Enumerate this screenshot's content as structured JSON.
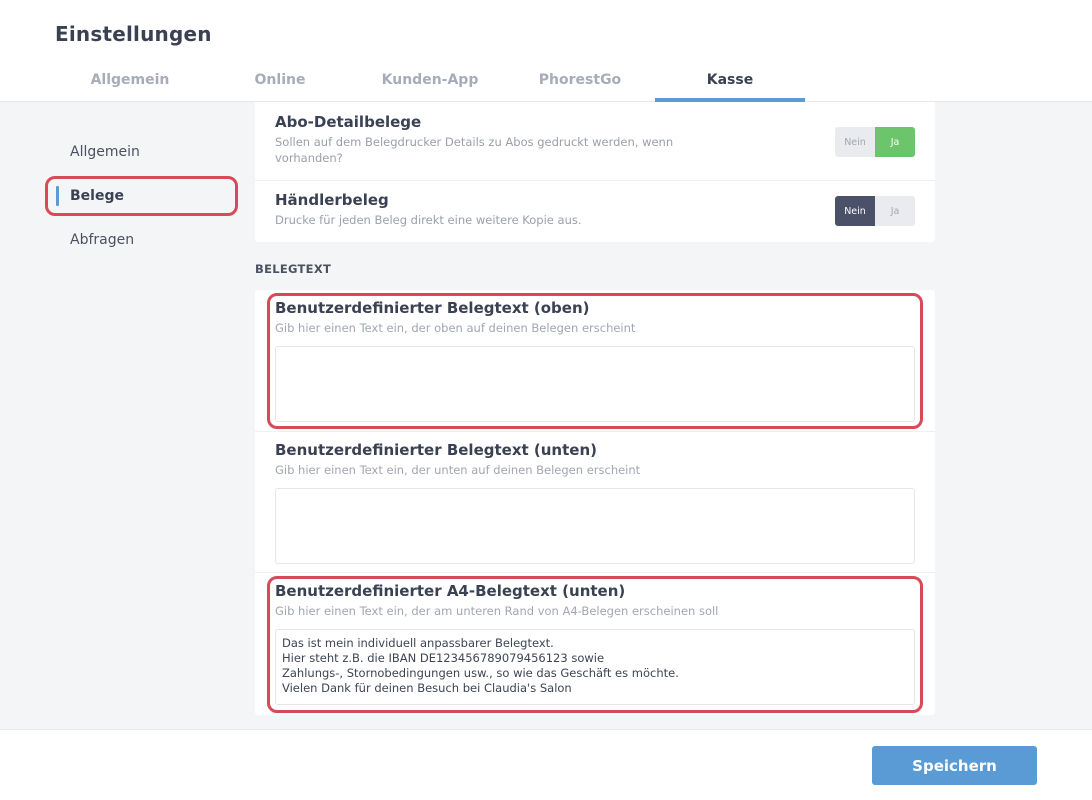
{
  "header": {
    "title": "Einstellungen",
    "tabs": [
      {
        "label": "Allgemein"
      },
      {
        "label": "Online"
      },
      {
        "label": "Kunden-App"
      },
      {
        "label": "PhorestGo"
      },
      {
        "label": "Kasse"
      }
    ],
    "active_tab": "Kasse"
  },
  "sidebar": {
    "items": [
      {
        "label": "Allgemein"
      },
      {
        "label": "Belege"
      },
      {
        "label": "Abfragen"
      }
    ],
    "active_item": "Belege"
  },
  "settings": [
    {
      "title": "Abo-Detailbelege",
      "description": "Sollen auf dem Belegdrucker Details zu Abos gedruckt werden, wenn vorhanden?",
      "toggle": {
        "no_label": "Nein",
        "yes_label": "Ja",
        "value": "Ja"
      }
    },
    {
      "title": "Händlerbeleg",
      "description": "Drucke für jeden Beleg direkt eine weitere Kopie aus.",
      "toggle": {
        "no_label": "Nein",
        "yes_label": "Ja",
        "value": "Nein"
      }
    }
  ],
  "belegtext": {
    "section_label": "BELEGTEXT",
    "fields": [
      {
        "title": "Benutzerdefinierter Belegtext (oben)",
        "description": "Gib hier einen Text ein, der oben auf deinen Belegen erscheint",
        "value": ""
      },
      {
        "title": "Benutzerdefinierter Belegtext (unten)",
        "description": "Gib hier einen Text ein, der unten auf deinen Belegen erscheint",
        "value": ""
      },
      {
        "title": "Benutzerdefinierter A4-Belegtext (unten)",
        "description": "Gib hier einen Text ein, der am unteren Rand von A4-Belegen erscheinen soll",
        "value": "Das ist mein individuell anpassbarer Belegtext.\nHier steht z.B. die IBAN DE123456789079456123 sowie\nZahlungs-, Stornobedingungen usw., so wie das Geschäft es möchte.\nVielen Dank für deinen Besuch bei Claudia's Salon"
      }
    ]
  },
  "footer": {
    "save_label": "Speichern"
  },
  "colors": {
    "accent": "#5b9bd5",
    "toggle_yes": "#6cc46b",
    "toggle_no_active": "#4a5168",
    "highlight": "#d94a58"
  }
}
